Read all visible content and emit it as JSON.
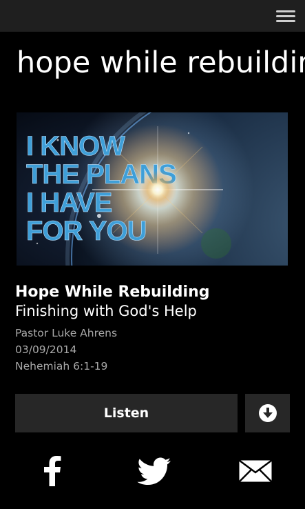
{
  "header": {
    "menu_icon": "hamburger-menu-icon"
  },
  "page": {
    "title": "hope while rebuilding"
  },
  "artwork": {
    "lines": [
      "I KNOW",
      "THE PLANS",
      "I HAVE",
      "FOR YOU"
    ],
    "text_color": "#3f9fd8"
  },
  "sermon": {
    "title": "Hope While Rebuilding",
    "subtitle": "Finishing with God's Help",
    "speaker": "Pastor Luke Ahrens",
    "date": "03/09/2014",
    "scripture": "Nehemiah 6:1-19"
  },
  "actions": {
    "listen_label": "Listen",
    "download_icon": "download-circle-icon"
  },
  "share": {
    "facebook_icon": "facebook-icon",
    "twitter_icon": "twitter-icon",
    "email_icon": "email-icon"
  }
}
